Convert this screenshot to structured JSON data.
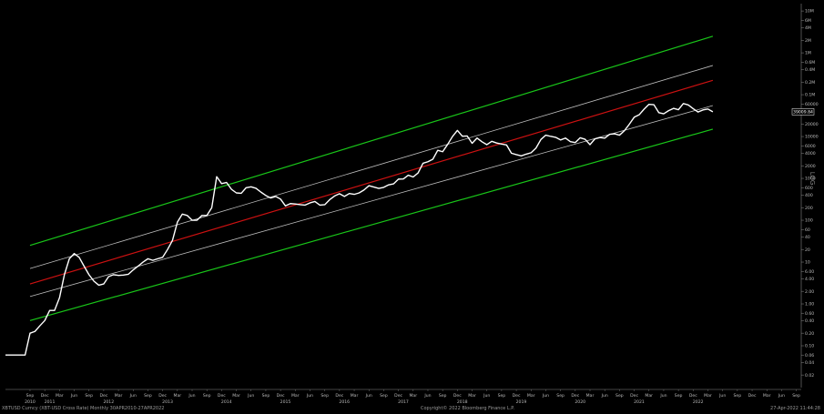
{
  "footer": {
    "left": "XBTUSD Curncy (XBT-USD Cross Rate)  Monthly 30APR2010-27APR2022",
    "middle": "Copyright© 2022 Bloomberg Finance L.P.",
    "right": "27-Apr-2022 11:44:28"
  },
  "chart_data": {
    "type": "line",
    "title": "",
    "xlabel": "",
    "ylabel": "",
    "scale": "log",
    "axis_label": "LOG",
    "grid": false,
    "background": "#000000",
    "colors": {
      "price": "#ffffff",
      "green_band": "#19c619",
      "white_band": "#bdbdbd",
      "red_band": "#cc1111",
      "last_price_box": "#000000"
    },
    "x_range": [
      "2010-04",
      "2023-10"
    ],
    "y_range": [
      0.01,
      15000000
    ],
    "y_ticks": [
      {
        "v": 10000000,
        "label": "10M"
      },
      {
        "v": 6000000,
        "label": "6M"
      },
      {
        "v": 4000000,
        "label": "4M"
      },
      {
        "v": 2000000,
        "label": "2M"
      },
      {
        "v": 1000000,
        "label": "1M"
      },
      {
        "v": 600000,
        "label": "0.6M"
      },
      {
        "v": 400000,
        "label": "0.4M"
      },
      {
        "v": 200000,
        "label": "0.2M"
      },
      {
        "v": 100000,
        "label": "0.1M"
      },
      {
        "v": 60000,
        "label": "60000"
      },
      {
        "v": 20000,
        "label": "20000"
      },
      {
        "v": 10000,
        "label": "10000"
      },
      {
        "v": 6000,
        "label": "6000"
      },
      {
        "v": 4000,
        "label": "4000"
      },
      {
        "v": 2000,
        "label": "2000"
      },
      {
        "v": 1000,
        "label": "1000"
      },
      {
        "v": 600,
        "label": "600"
      },
      {
        "v": 400,
        "label": "400"
      },
      {
        "v": 200,
        "label": "200"
      },
      {
        "v": 100,
        "label": "100"
      },
      {
        "v": 60,
        "label": "60"
      },
      {
        "v": 40,
        "label": "40"
      },
      {
        "v": 20,
        "label": "20"
      },
      {
        "v": 10,
        "label": "10"
      },
      {
        "v": 6,
        "label": "6.00"
      },
      {
        "v": 4,
        "label": "4.00"
      },
      {
        "v": 2,
        "label": "2.00"
      },
      {
        "v": 1,
        "label": "1.00"
      },
      {
        "v": 0.6,
        "label": "0.60"
      },
      {
        "v": 0.4,
        "label": "0.40"
      },
      {
        "v": 0.2,
        "label": "0.20"
      },
      {
        "v": 0.1,
        "label": "0.10"
      },
      {
        "v": 0.06,
        "label": "0.06"
      },
      {
        "v": 0.04,
        "label": "0.04"
      },
      {
        "v": 0.02,
        "label": "0.02"
      }
    ],
    "last_price": {
      "x": "2022-04",
      "value": 39009.84,
      "label": "39009.84"
    },
    "x_month_labels": [
      "Sep",
      "Dec",
      "Mar",
      "Jun"
    ],
    "x_years": [
      "2010",
      "2011",
      "2012",
      "2013",
      "2014",
      "2015",
      "2016",
      "2017",
      "2018",
      "2019",
      "2020",
      "2021",
      "2022"
    ],
    "bands": [
      {
        "name": "upper_green",
        "color": "#19c619",
        "start": {
          "x": "2010-09",
          "value": 25
        },
        "end": {
          "x": "2022-04",
          "value": 2500000
        }
      },
      {
        "name": "upper_white",
        "color": "#bdbdbd",
        "start": {
          "x": "2010-09",
          "value": 7
        },
        "end": {
          "x": "2022-04",
          "value": 500000
        }
      },
      {
        "name": "red_mid",
        "color": "#cc1111",
        "start": {
          "x": "2010-09",
          "value": 3
        },
        "end": {
          "x": "2022-04",
          "value": 220000
        }
      },
      {
        "name": "lower_white",
        "color": "#bdbdbd",
        "start": {
          "x": "2010-09",
          "value": 1.5
        },
        "end": {
          "x": "2022-04",
          "value": 55000
        }
      },
      {
        "name": "lower_green",
        "color": "#19c619",
        "start": {
          "x": "2010-09",
          "value": 0.4
        },
        "end": {
          "x": "2022-04",
          "value": 15000
        }
      }
    ],
    "series": [
      {
        "points": [
          [
            "2010-04",
            0.06
          ],
          [
            "2010-07",
            0.06
          ],
          [
            "2010-08",
            0.06
          ],
          [
            "2010-09",
            0.2
          ],
          [
            "2010-10",
            0.22
          ],
          [
            "2010-11",
            0.3
          ],
          [
            "2010-12",
            0.4
          ],
          [
            "2011-01",
            0.7
          ],
          [
            "2011-02",
            0.7
          ],
          [
            "2011-03",
            1.4
          ],
          [
            "2011-04",
            5
          ],
          [
            "2011-05",
            12
          ],
          [
            "2011-06",
            16
          ],
          [
            "2011-07",
            13
          ],
          [
            "2011-08",
            8
          ],
          [
            "2011-09",
            5
          ],
          [
            "2011-10",
            3.5
          ],
          [
            "2011-11",
            2.8
          ],
          [
            "2011-12",
            3
          ],
          [
            "2012-01",
            4.5
          ],
          [
            "2012-02",
            5
          ],
          [
            "2012-03",
            4.8
          ],
          [
            "2012-04",
            4.9
          ],
          [
            "2012-05",
            5.1
          ],
          [
            "2012-06",
            6.5
          ],
          [
            "2012-07",
            8
          ],
          [
            "2012-08",
            10
          ],
          [
            "2012-09",
            12
          ],
          [
            "2012-10",
            11
          ],
          [
            "2012-11",
            12
          ],
          [
            "2012-12",
            13
          ],
          [
            "2013-01",
            20
          ],
          [
            "2013-02",
            33
          ],
          [
            "2013-03",
            90
          ],
          [
            "2013-04",
            140
          ],
          [
            "2013-05",
            130
          ],
          [
            "2013-06",
            100
          ],
          [
            "2013-07",
            100
          ],
          [
            "2013-08",
            130
          ],
          [
            "2013-09",
            130
          ],
          [
            "2013-10",
            200
          ],
          [
            "2013-11",
            1100
          ],
          [
            "2013-12",
            750
          ],
          [
            "2014-01",
            800
          ],
          [
            "2014-02",
            550
          ],
          [
            "2014-03",
            450
          ],
          [
            "2014-04",
            440
          ],
          [
            "2014-05",
            600
          ],
          [
            "2014-06",
            630
          ],
          [
            "2014-07",
            580
          ],
          [
            "2014-08",
            470
          ],
          [
            "2014-09",
            390
          ],
          [
            "2014-10",
            340
          ],
          [
            "2014-11",
            370
          ],
          [
            "2014-12",
            320
          ],
          [
            "2015-01",
            220
          ],
          [
            "2015-02",
            250
          ],
          [
            "2015-03",
            245
          ],
          [
            "2015-04",
            235
          ],
          [
            "2015-05",
            230
          ],
          [
            "2015-06",
            260
          ],
          [
            "2015-07",
            280
          ],
          [
            "2015-08",
            230
          ],
          [
            "2015-09",
            235
          ],
          [
            "2015-10",
            310
          ],
          [
            "2015-11",
            380
          ],
          [
            "2015-12",
            430
          ],
          [
            "2016-01",
            370
          ],
          [
            "2016-02",
            435
          ],
          [
            "2016-03",
            415
          ],
          [
            "2016-04",
            450
          ],
          [
            "2016-05",
            530
          ],
          [
            "2016-06",
            670
          ],
          [
            "2016-07",
            620
          ],
          [
            "2016-08",
            575
          ],
          [
            "2016-09",
            610
          ],
          [
            "2016-10",
            700
          ],
          [
            "2016-11",
            740
          ],
          [
            "2016-12",
            960
          ],
          [
            "2017-01",
            970
          ],
          [
            "2017-02",
            1190
          ],
          [
            "2017-03",
            1080
          ],
          [
            "2017-04",
            1350
          ],
          [
            "2017-05",
            2300
          ],
          [
            "2017-06",
            2500
          ],
          [
            "2017-07",
            2870
          ],
          [
            "2017-08",
            4700
          ],
          [
            "2017-09",
            4340
          ],
          [
            "2017-10",
            6450
          ],
          [
            "2017-11",
            10000
          ],
          [
            "2017-12",
            14000
          ],
          [
            "2018-01",
            10200
          ],
          [
            "2018-02",
            10300
          ],
          [
            "2018-03",
            6900
          ],
          [
            "2018-04",
            9200
          ],
          [
            "2018-05",
            7500
          ],
          [
            "2018-06",
            6400
          ],
          [
            "2018-07",
            7700
          ],
          [
            "2018-08",
            7000
          ],
          [
            "2018-09",
            6600
          ],
          [
            "2018-10",
            6300
          ],
          [
            "2018-11",
            4000
          ],
          [
            "2018-12",
            3700
          ],
          [
            "2019-01",
            3450
          ],
          [
            "2019-02",
            3800
          ],
          [
            "2019-03",
            4100
          ],
          [
            "2019-04",
            5300
          ],
          [
            "2019-05",
            8500
          ],
          [
            "2019-06",
            10800
          ],
          [
            "2019-07",
            10100
          ],
          [
            "2019-08",
            9600
          ],
          [
            "2019-09",
            8300
          ],
          [
            "2019-10",
            9200
          ],
          [
            "2019-11",
            7550
          ],
          [
            "2019-12",
            7200
          ],
          [
            "2020-01",
            9350
          ],
          [
            "2020-02",
            8600
          ],
          [
            "2020-03",
            6400
          ],
          [
            "2020-04",
            8800
          ],
          [
            "2020-05",
            9450
          ],
          [
            "2020-06",
            9140
          ],
          [
            "2020-07",
            11350
          ],
          [
            "2020-08",
            11650
          ],
          [
            "2020-09",
            10780
          ],
          [
            "2020-10",
            13800
          ],
          [
            "2020-11",
            19700
          ],
          [
            "2020-12",
            29000
          ],
          [
            "2021-01",
            33100
          ],
          [
            "2021-02",
            45100
          ],
          [
            "2021-03",
            58800
          ],
          [
            "2021-04",
            57700
          ],
          [
            "2021-05",
            37300
          ],
          [
            "2021-06",
            35000
          ],
          [
            "2021-07",
            41500
          ],
          [
            "2021-08",
            47100
          ],
          [
            "2021-09",
            43800
          ],
          [
            "2021-10",
            61300
          ],
          [
            "2021-11",
            57000
          ],
          [
            "2021-12",
            46300
          ],
          [
            "2022-01",
            38500
          ],
          [
            "2022-02",
            43200
          ],
          [
            "2022-03",
            45500
          ],
          [
            "2022-04",
            39009.84
          ]
        ]
      }
    ]
  }
}
